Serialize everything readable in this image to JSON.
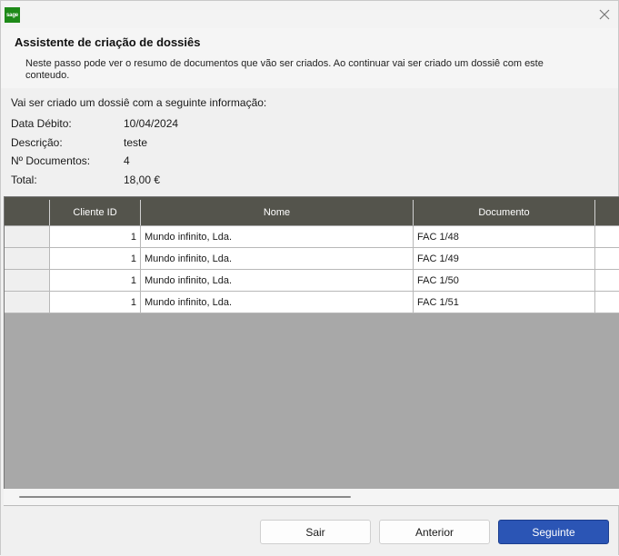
{
  "window": {
    "logo_text": "sage",
    "close_glyph": "✕",
    "title": "Assistente de criação de dossiês",
    "description": "Neste passo pode ver o resumo de documentos que vão ser criados. Ao continuar vai ser criado um dossiê com este conteudo."
  },
  "summary": {
    "intro": "Vai ser criado um dossiê com a seguinte informação:",
    "fields": [
      {
        "label": "Data Débito:",
        "value": "10/04/2024"
      },
      {
        "label": "Descrição:",
        "value": "teste"
      },
      {
        "label": "Nº Documentos:",
        "value": "4"
      },
      {
        "label": "Total:",
        "value": "18,00 €"
      }
    ]
  },
  "grid": {
    "columns": [
      "",
      "Cliente ID",
      "Nome",
      "Documento",
      ""
    ],
    "rows": [
      {
        "cliente_id": "1",
        "nome": "Mundo infinito, Lda.",
        "documento": "FAC 1/48"
      },
      {
        "cliente_id": "1",
        "nome": "Mundo infinito, Lda.",
        "documento": "FAC 1/49"
      },
      {
        "cliente_id": "1",
        "nome": "Mundo infinito, Lda.",
        "documento": "FAC 1/50"
      },
      {
        "cliente_id": "1",
        "nome": "Mundo infinito, Lda.",
        "documento": "FAC 1/51"
      }
    ]
  },
  "buttons": {
    "exit": "Sair",
    "previous": "Anterior",
    "next": "Seguinte"
  },
  "colors": {
    "grid_header": "#54544c",
    "primary_button": "#2b55b5",
    "logo": "#1e8a18"
  }
}
